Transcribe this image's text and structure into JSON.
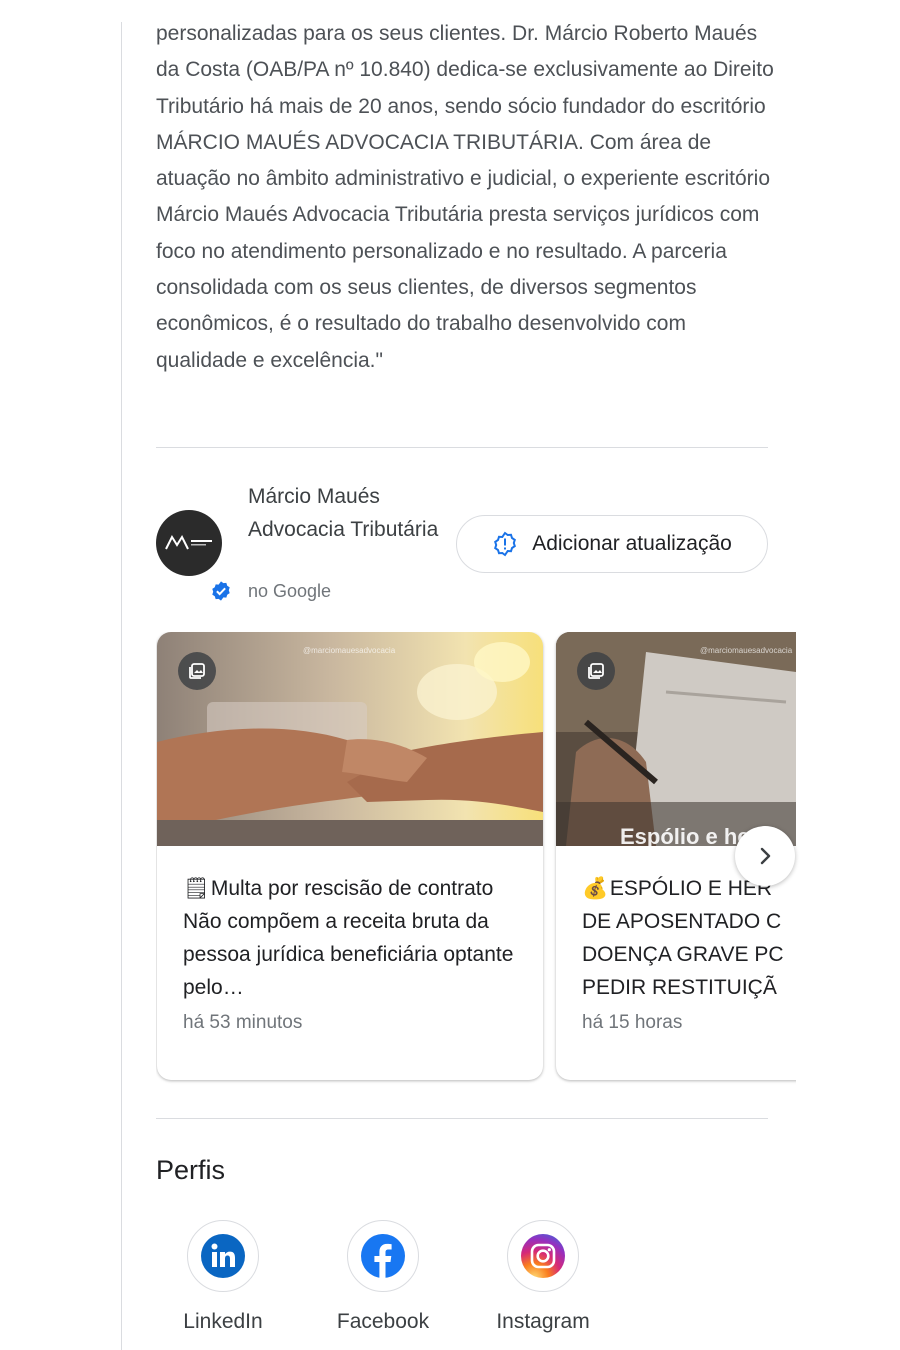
{
  "knowledge_panel": {
    "description": "personalizadas para os seus clientes. Dr. Márcio Roberto Maués da Costa (OAB/PA nº 10.840) dedica-se exclusivamente ao Direito Tributário há mais de 20 anos, sendo sócio fundador do escritório MÁRCIO MAUÉS ADVOCACIA TRIBUTÁRIA. Com área de atuação no âmbito administrativo e judicial, o experiente escritório Márcio Maués Advocacia Tributária presta serviços jurídicos com foco no atendimento personalizado e no resultado. A parceria consolidada com os seus clientes, de diversos segmentos econômicos, é o resultado do trabalho desenvolvido com qualidade e excelência.\""
  },
  "business": {
    "name": "Márcio Maués Advocacia Tributária",
    "source": "no Google",
    "add_update_label": "Adicionar atualização"
  },
  "posts": [
    {
      "emoji": "🗒",
      "text": "Multa por rescisão de contrato Não compõem a receita bruta da pessoa jurídica beneficiária optante pelo…",
      "time": "há 53 minutos",
      "watermark": "@marciomauesadvocacia"
    },
    {
      "emoji": "💰",
      "lines": [
        "ESPÓLIO E HER",
        "DE APOSENTADO C",
        "DOENÇA GRAVE PC",
        "PEDIR RESTITUIÇÃ"
      ],
      "image_caption": "Espólio e herd",
      "time": "há 15 horas",
      "watermark": "@marciomauesadvocacia"
    }
  ],
  "profiles": {
    "title": "Perfis",
    "items": [
      {
        "label": "LinkedIn",
        "color": "#0a66c2"
      },
      {
        "label": "Facebook",
        "color": "#1877f2"
      },
      {
        "label": "Instagram",
        "color": "#d62976"
      }
    ]
  },
  "colors": {
    "verified": "#1a73e8",
    "divider": "#dadce0",
    "muted_text": "#70757a"
  }
}
